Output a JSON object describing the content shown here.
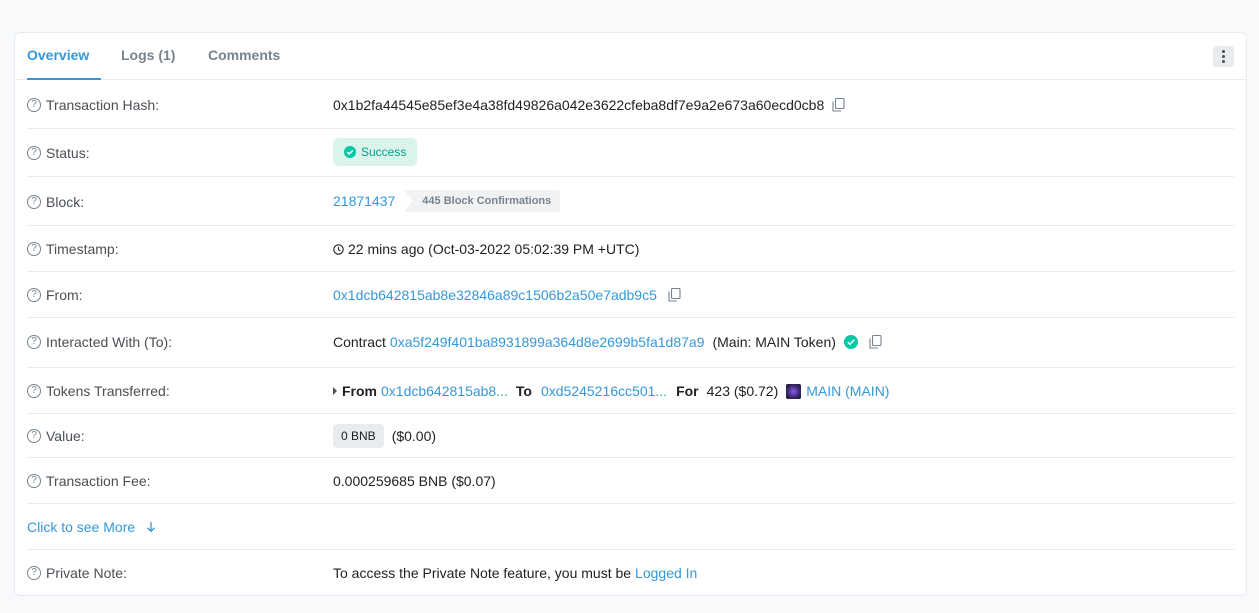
{
  "tabs": [
    {
      "label": "Overview"
    },
    {
      "label": "Logs (1)"
    },
    {
      "label": "Comments"
    }
  ],
  "rows": {
    "hash": {
      "label": "Transaction Hash:",
      "value": "0x1b2fa44545e85ef3e4a38fd49826a042e3622cfeba8df7e9a2e673a60ecd0cb8"
    },
    "status": {
      "label": "Status:",
      "value": "Success"
    },
    "block": {
      "label": "Block:",
      "value": "21871437",
      "confirmations": "445 Block Confirmations"
    },
    "timestamp": {
      "label": "Timestamp:",
      "value": "22 mins ago (Oct-03-2022 05:02:39 PM +UTC)"
    },
    "from": {
      "label": "From:",
      "value": "0x1dcb642815ab8e32846a89c1506b2a50e7adb9c5"
    },
    "to": {
      "label": "Interacted With (To):",
      "prefix": "Contract",
      "address": "0xa5f249f401ba8931899a364d8e2699b5fa1d87a9",
      "suffix": "(Main: MAIN Token)"
    },
    "tokens": {
      "label": "Tokens Transferred:",
      "from_label": "From",
      "from": "0x1dcb642815ab8...",
      "to_label": "To",
      "to": "0xd5245216cc501...",
      "for_label": "For",
      "amount": "423 ($0.72)",
      "token": "MAIN (MAIN)"
    },
    "value": {
      "label": "Value:",
      "amount": "0 BNB",
      "usd": "($0.00)"
    },
    "fee": {
      "label": "Transaction Fee:",
      "value": "0.000259685 BNB ($0.07)"
    },
    "more": {
      "label": "Click to see More"
    },
    "note": {
      "label": "Private Note:",
      "text": "To access the Private Note feature, you must be",
      "link": "Logged In"
    }
  },
  "colors": {
    "accent": "#3498db",
    "success": "#00c9a7",
    "success_bg": "#daf4eb"
  }
}
